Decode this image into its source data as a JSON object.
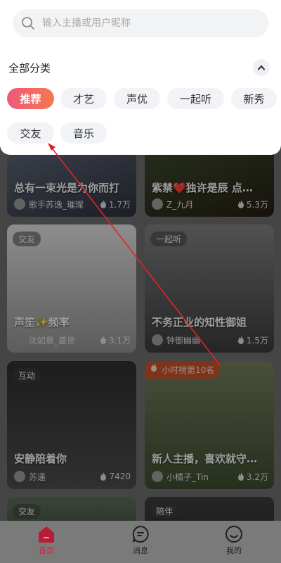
{
  "search": {
    "placeholder": "输入主播或用户昵称"
  },
  "categories": {
    "title": "全部分类",
    "items": [
      "推荐",
      "才艺",
      "声优",
      "一起听",
      "新秀",
      "交友",
      "音乐"
    ],
    "active": "推荐"
  },
  "feed": {
    "cards": [
      {
        "title": "总有一束光是为你而打",
        "user": "歌手苏逸_璀璨",
        "hot": "1.7万",
        "tag": ""
      },
      {
        "title": "紫禁❤️独许是辰 点…",
        "user": "Z_九月",
        "hot": "5.3万",
        "tag": ""
      },
      {
        "title": "声笙✨频率",
        "user": "沈如意_盛世",
        "hot": "3.1万",
        "tag": "交友"
      },
      {
        "title": "不务正业的知性御姐",
        "user": "钟御幽幽",
        "hot": "1.5万",
        "tag": "一起听"
      },
      {
        "title": "安静陪着你",
        "user": "苏遥",
        "hot": "7420",
        "tag": "互动"
      },
      {
        "title": "新人主播，喜欢就守…",
        "user": "小橘子_Tin",
        "hot": "3.2万",
        "rank": "小时榜第10名"
      },
      {
        "tag": "交友"
      },
      {
        "tag": "陪伴"
      }
    ]
  },
  "tabbar": {
    "home": "首页",
    "messages": "消息",
    "mine": "我的"
  },
  "colors": {
    "accent": "#f0587b",
    "accent_end": "#f4794f",
    "annotation_arrow": "#e0232b"
  }
}
